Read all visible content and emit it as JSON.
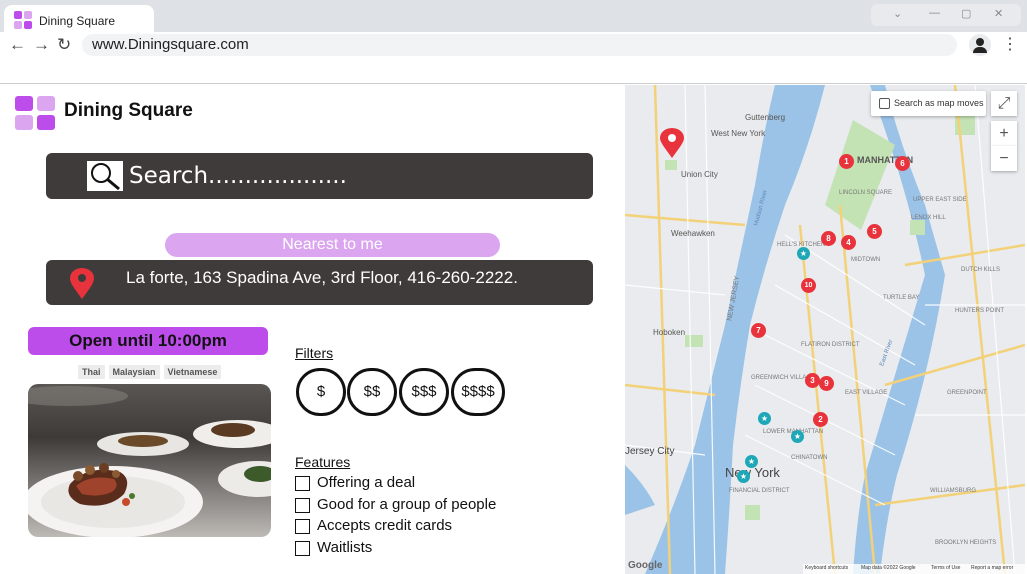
{
  "browser": {
    "tab_title": "Dining Square",
    "url": "www.Diningsquare.com",
    "nav": {
      "back": "←",
      "forward": "→",
      "reload": "↻"
    },
    "window_buttons": {
      "minimize": "⌄",
      "restore": "—",
      "maximize": "▢",
      "close": "✕"
    },
    "menu": "⋮"
  },
  "colors": {
    "accent": "#bd4dea",
    "accent_light": "#dba5ef",
    "dark_bar": "#403b3b",
    "pin_red": "#e8333d"
  },
  "header": {
    "brand": "Dining Square"
  },
  "search": {
    "placeholder": "Search...................",
    "icon": "search-icon"
  },
  "location": {
    "nearest_label": "Nearest to me",
    "address": "La forte, 163 Spadina Ave, 3rd Floor, 416-260-2222.",
    "icon": "map-pin-icon"
  },
  "restaurant": {
    "hours": "Open until 10:00pm",
    "cuisines": [
      "Thai",
      "Malaysian",
      "Vietnamese"
    ]
  },
  "filters": {
    "heading": "Filters",
    "price_levels": [
      "$",
      "$$",
      "$$$",
      "$$$$"
    ]
  },
  "features": {
    "heading": "Features",
    "items": [
      "Offering a deal",
      "Good for a group of people",
      "Accepts credit cards",
      "Waitlists"
    ]
  },
  "map": {
    "search_as_moves": "Search as map moves",
    "zoom_in": "+",
    "zoom_out": "−",
    "fullscreen": "⤢",
    "labels": [
      "Guttenberg",
      "West New York",
      "MANHATTAN",
      "Union City",
      "Weehawken",
      "Hoboken",
      "Jersey City",
      "New York",
      "HELL'S KITCHEN",
      "NEW JERSEY",
      "MIDTOWN",
      "GREENPOINT",
      "WILLIAMSBURG",
      "GREENWICH VILLAGE",
      "CHINATOWN",
      "FINANCIAL DISTRICT",
      "EAST VILLAGE",
      "LOWER MANHATTAN",
      "LINCOLN SQUARE",
      "UPPER EAST SIDE",
      "DUTCH KILLS",
      "HUNTERS POINT",
      "LENOX HILL",
      "TURTLE BAY",
      "FLATIRON DISTRICT",
      "BROOKLYN HEIGHTS",
      "Hudson River",
      "East River"
    ],
    "markers": [
      "1",
      "2",
      "3",
      "4",
      "5",
      "6",
      "7",
      "8",
      "9",
      "10"
    ],
    "footer": [
      "Google",
      "Keyboard shortcuts",
      "Map data ©2022 Google",
      "Terms of Use",
      "Report a map error"
    ]
  }
}
